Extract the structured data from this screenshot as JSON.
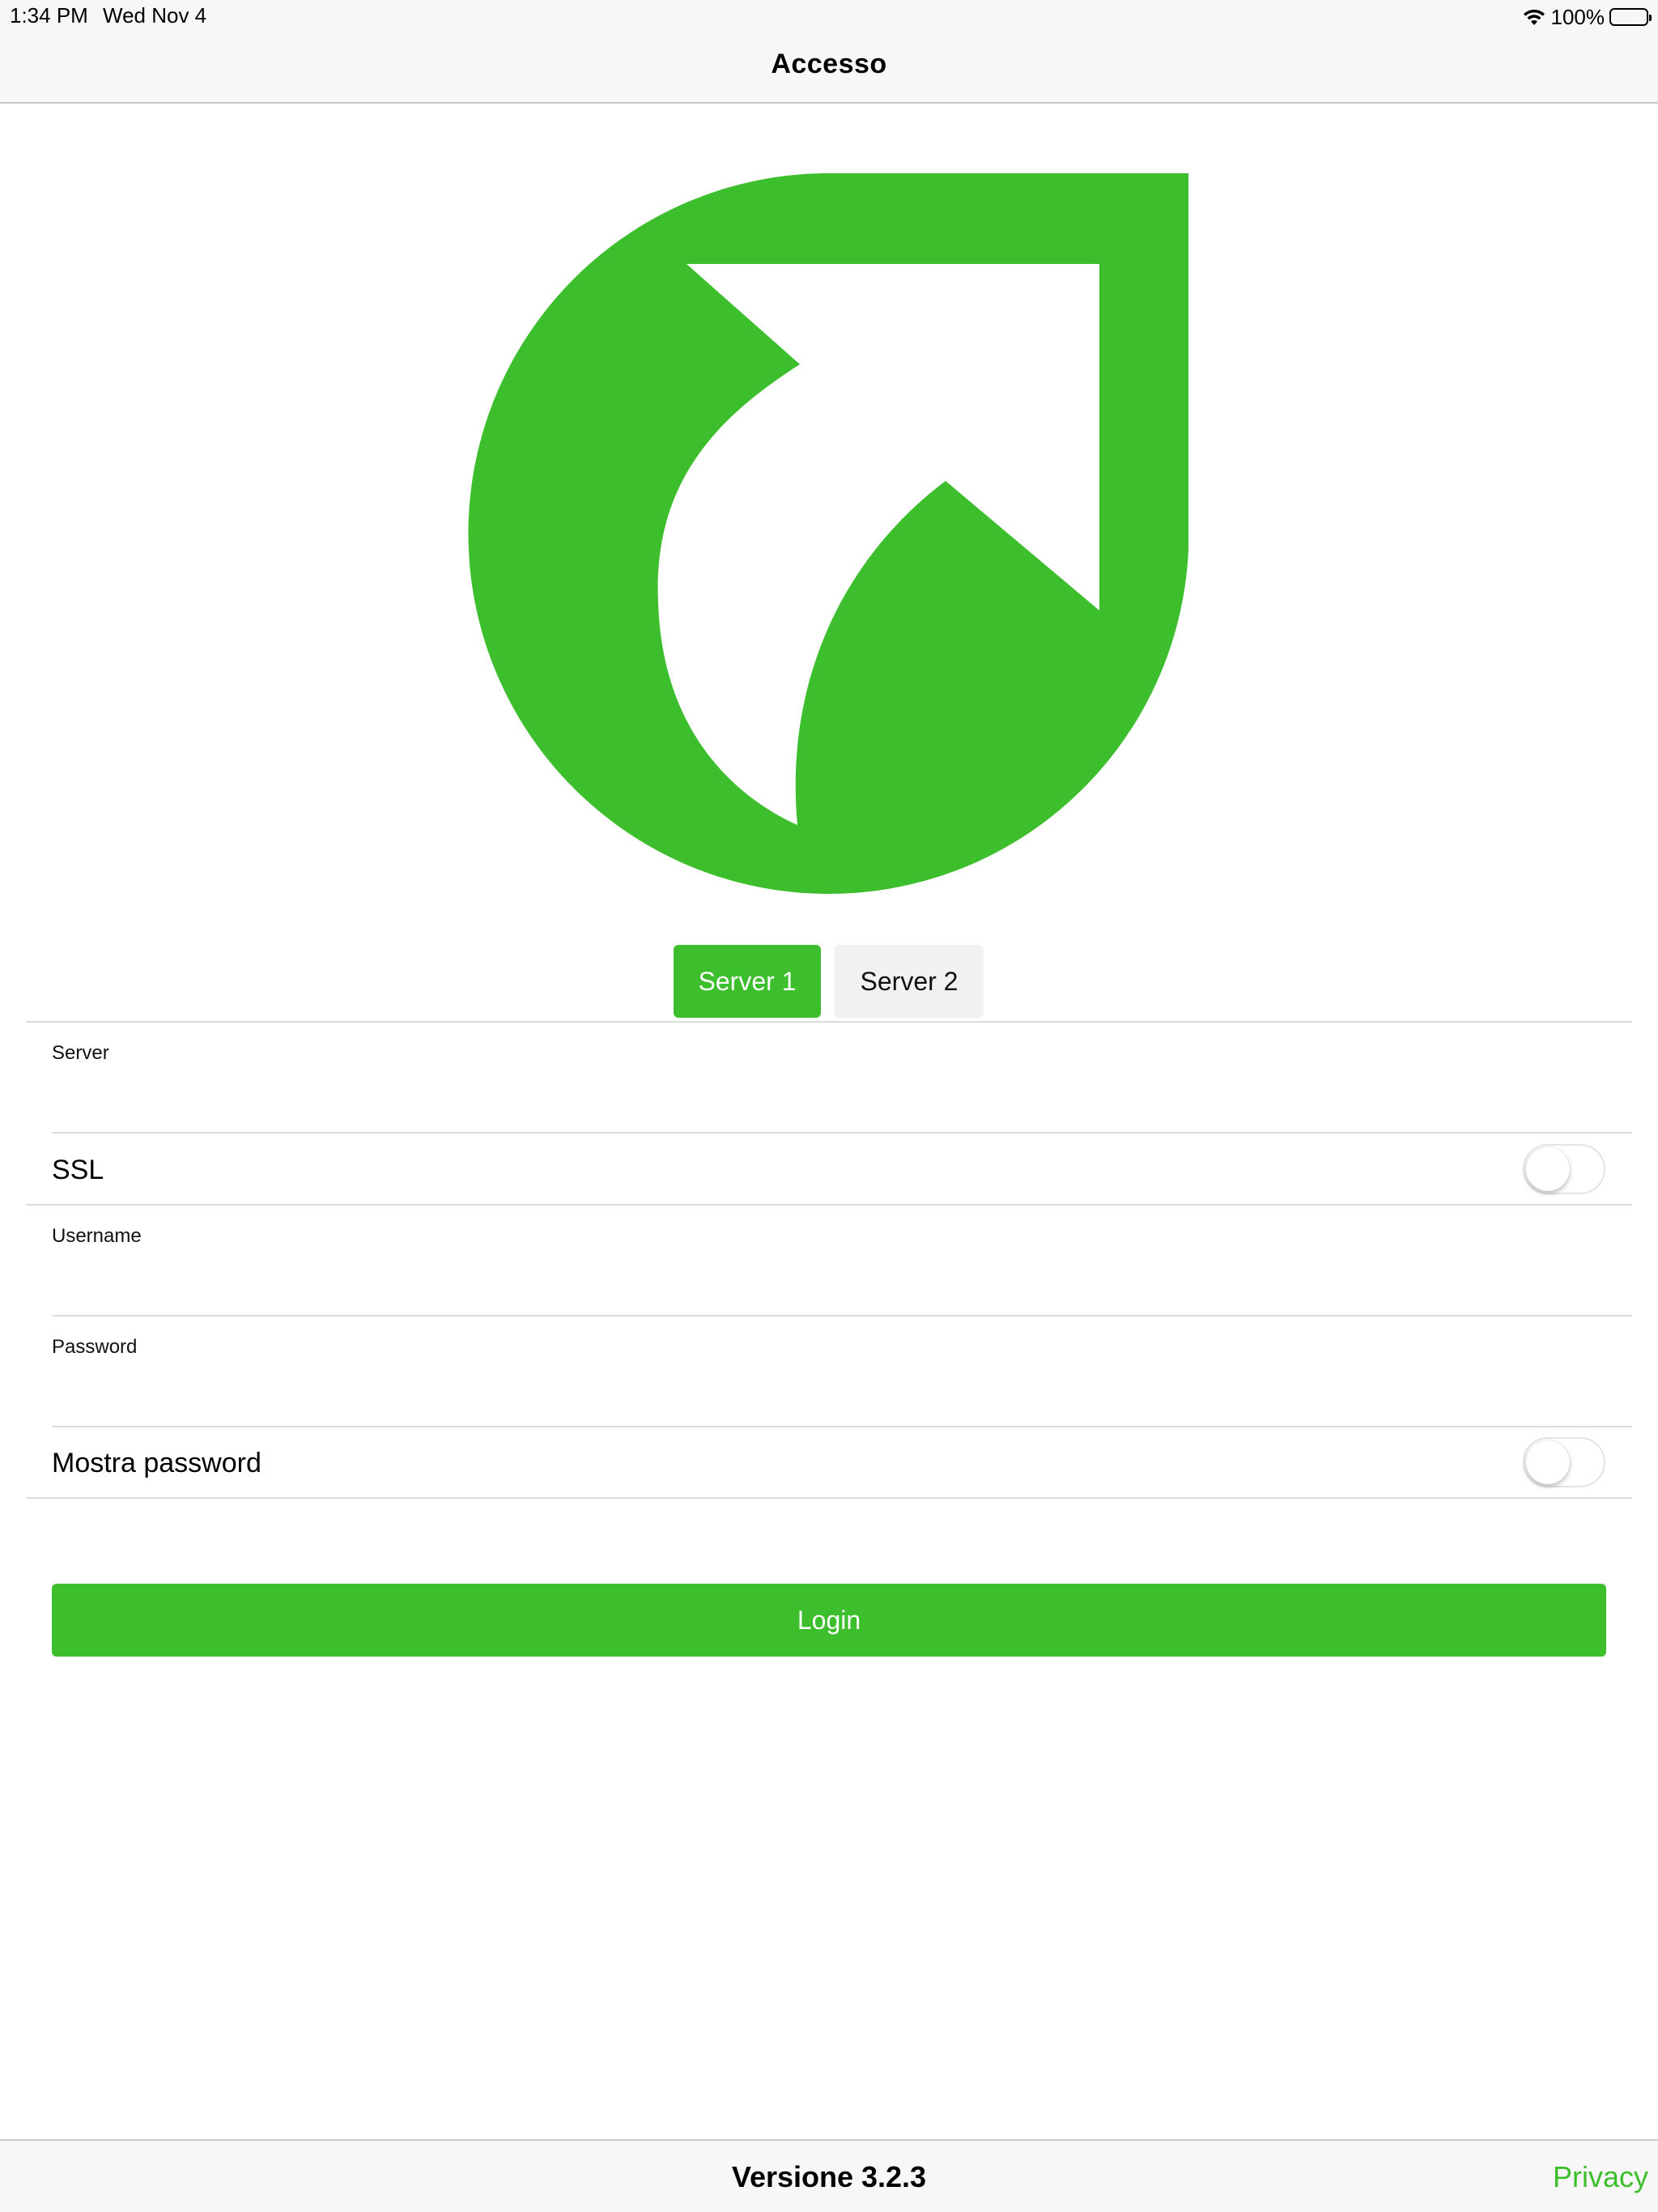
{
  "status_bar": {
    "time": "1:34 PM",
    "date": "Wed Nov 4",
    "battery": "100%",
    "icons": [
      "wifi-icon",
      "battery-icon"
    ]
  },
  "nav": {
    "title": "Accesso"
  },
  "logo": {
    "icon": "app-logo-arrow-leaf",
    "color": "#3dbe2d"
  },
  "server_tabs": [
    {
      "label": "Server 1",
      "selected": true
    },
    {
      "label": "Server 2",
      "selected": false
    }
  ],
  "form": {
    "server": {
      "label": "Server",
      "value": ""
    },
    "ssl": {
      "label": "SSL",
      "on": false
    },
    "username": {
      "label": "Username",
      "value": ""
    },
    "password": {
      "label": "Password",
      "value": ""
    },
    "show_password": {
      "label": "Mostra password",
      "on": false
    }
  },
  "login_button": {
    "label": "Login"
  },
  "footer": {
    "version": "Versione 3.2.3",
    "privacy": "Privacy"
  },
  "colors": {
    "accent": "#3dbe2d",
    "bar_background": "#f7f7f7"
  }
}
